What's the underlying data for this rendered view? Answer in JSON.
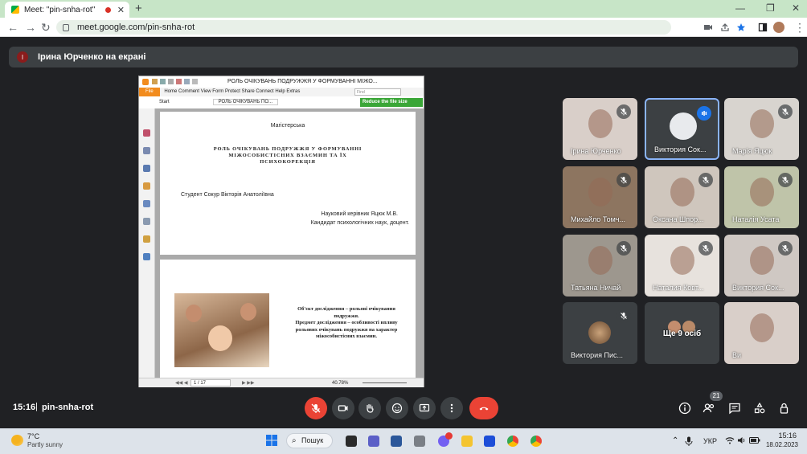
{
  "browser": {
    "tab_title": "Meet: \"pin-snha-rot\"",
    "tab_close": "✕",
    "new_tab": "+",
    "url": "meet.google.com/pin-snha-rot",
    "window_controls": [
      "—",
      "❐",
      "✕"
    ]
  },
  "meet": {
    "presenter_initial": "І",
    "presenter_text": "Ірина Юрченко на екрані",
    "time": "15:16",
    "meeting_code": "pin-snha-rot",
    "participants_count": "21"
  },
  "pdf": {
    "window_title": "РОЛЬ ОЧІКУВАНЬ ПОДРУЖЖЯ У ФОРМУВАННІ МІЖО...",
    "menu_file": "File",
    "menu_items": [
      "Home",
      "Comment",
      "View",
      "Form",
      "Protect",
      "Share",
      "Connect",
      "Help",
      "Extras"
    ],
    "find_placeholder": "Find",
    "reduce_label": "Reduce the file size",
    "tab_start": "Start",
    "tab_doc": "РОЛЬ ОЧІКУВАНЬ ПО...",
    "page_label": "Магістерська",
    "title_lines": [
      "РОЛЬ ОЧІКУВАНЬ ПОДРУЖЖЯ У ФОРМУВАННІ",
      "МІЖОСОБИСТІСНИХ ВЗАЄМИН ТА ЇХ",
      "ПСИХОКОРЕКЦІЯ"
    ],
    "student": "Студент Сокур Вікторія Анатоліївна",
    "supervisor": "Науковий керівник Яцюк М.В.",
    "supervisor_degree": "Кандидат психологічних наук, доцент.",
    "slide2_lines": [
      "Об'єкт дослідження – рольові очікування",
      "подружжя.",
      "Предмет дослідження – особливості впливу",
      "рольових очікувань подружжя на характер",
      "міжособистісних взаємин."
    ],
    "page_indicator": "1 / 17",
    "zoom": "40.78%"
  },
  "tiles": [
    {
      "name": "Ірина Юрченко",
      "bg": "#d9cfc9"
    },
    {
      "name": "Виктория Сок...",
      "bg": "#3c4043"
    },
    {
      "name": "Марія Яцюк",
      "bg": "#d8d4cf"
    },
    {
      "name": "Михайло Томч...",
      "bg": "#8d7560"
    },
    {
      "name": "Оксана Шпор...",
      "bg": "#cfc6bd"
    },
    {
      "name": "Наталія Усата",
      "bg": "#bfc4a9"
    },
    {
      "name": "Татьяна Ничай",
      "bg": "#9d978e"
    },
    {
      "name": "Наталия Ковт...",
      "bg": "#e7e2dd"
    },
    {
      "name": "Виктория Сок...",
      "bg": "#cfc8c3"
    },
    {
      "name": "Виктория Пис...",
      "bg": "#3c4043"
    },
    {
      "name": "Ще 9 осіб",
      "bg": "#3c4043"
    },
    {
      "name": "Ви",
      "bg": "#d9cfc9"
    }
  ],
  "taskbar": {
    "weather_temp": "7°C",
    "weather_desc": "Partly sunny",
    "search_label": "Пошук",
    "lang": "УКР",
    "time": "15:16",
    "date": "18.02.2023"
  },
  "colors": {
    "leave_red": "#ea4335",
    "mute_red": "#ea4335",
    "meet_bg": "#202124",
    "tile_bg": "#3c4043"
  }
}
